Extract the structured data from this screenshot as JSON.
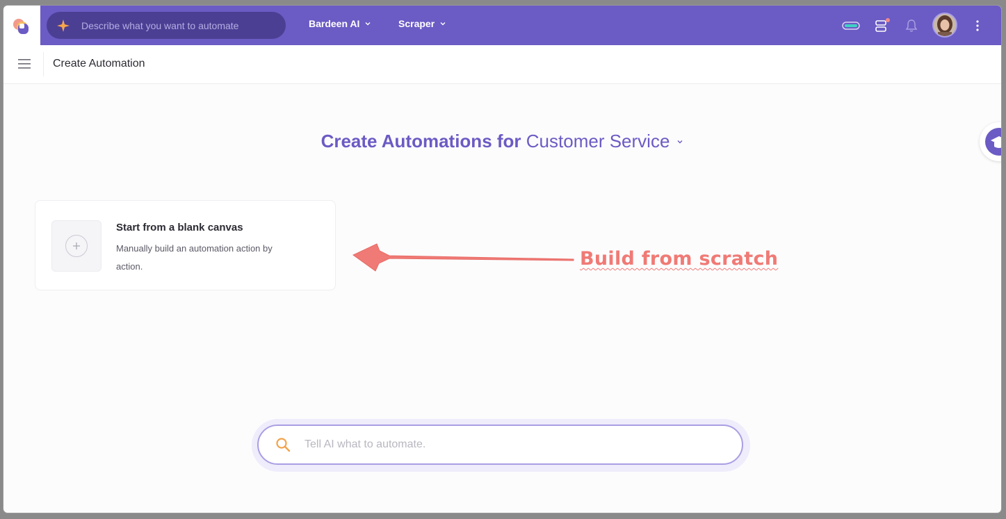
{
  "topbar": {
    "prompt_placeholder": "Describe what you want to automate",
    "menus": [
      {
        "label": "Bardeen AI"
      },
      {
        "label": "Scraper"
      }
    ]
  },
  "subheader": {
    "title": "Create Automation"
  },
  "heading": {
    "prefix": "Create Automations for",
    "category": "Customer Service"
  },
  "blank_card": {
    "title": "Start from a blank canvas",
    "description": "Manually build an automation action by action."
  },
  "annotation": {
    "text": "Build from scratch",
    "color": "#f07a75"
  },
  "ai_search": {
    "placeholder": "Tell AI what to automate."
  },
  "colors": {
    "brand": "#6b5bc4",
    "prompt_bg": "#4b3f94",
    "search_icon": "#f2a34a",
    "notification_dot": "#f08a8a",
    "toggle_accent": "#3fd1c4"
  },
  "icons": [
    "bardeen-logo-icon",
    "sparkle-icon",
    "chevron-down-icon",
    "toggle-icon",
    "stack-icon",
    "bell-icon",
    "kebab-icon",
    "hamburger-icon",
    "plus-icon",
    "search-icon",
    "graduation-cap-icon"
  ]
}
